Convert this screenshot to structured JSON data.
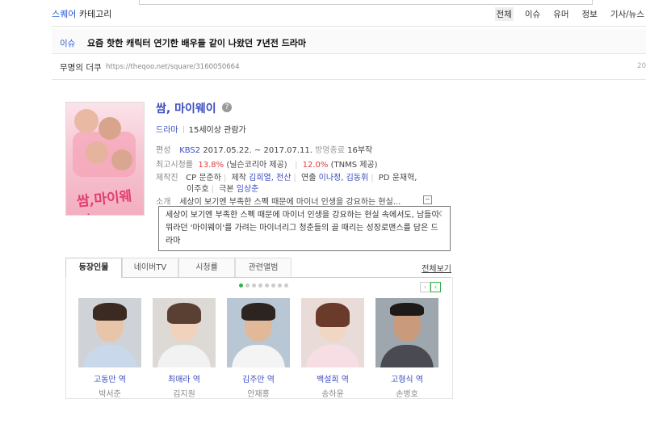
{
  "category": {
    "title_prefix": "스퀘어",
    "title_suffix": " 카테고리",
    "nav": [
      "전체",
      "이슈",
      "유머",
      "정보",
      "기사/뉴스"
    ]
  },
  "issue": {
    "tag": "이슈",
    "headline": "요즘 핫한 캐릭터 연기한 배우들 같이 나왔던 7년전 드라마"
  },
  "source": {
    "name": "무명의 더쿠",
    "url": "https://theqoo.net/square/3160050664",
    "number": "20"
  },
  "drama": {
    "title": "쌈, 마이웨이",
    "help": "?",
    "genre": "드라마",
    "rating_age": "15세이상 관람가",
    "poster_text": "쌈,마이웨이",
    "broadcast": {
      "label": "편성",
      "channel": "KBS2",
      "dates": " 2017.05.22. ~ 2017.07.11. ",
      "status": "방영종료",
      "episodes": " 16부작"
    },
    "viewership": {
      "label": "최고시청률",
      "value1": "13.8%",
      "src1": "(닐슨코리아 제공)",
      "value2": "12.0%",
      "src2": "(TNMS 제공)"
    },
    "crew": {
      "label": "제작진",
      "cp_label": "CP",
      "cp": "문준하",
      "prod_label": "제작",
      "prod": "김희열, 전산",
      "dir_label": "연출",
      "dir": "이나정, 김동휘",
      "pd_label": "PD",
      "pd": "윤재혁,",
      "pd2": "이주호",
      "writer_label": "극본",
      "writer": "임상춘"
    },
    "summary": {
      "label": "소개",
      "short": "세상이 보기엔 부족한 스펙 때문에 마이너 인생을 강요하는 현실...",
      "toggle": "−"
    },
    "popup": {
      "text": "세상이 보기엔 부족한 스펙 때문에 마이너 인생을 강요하는 현실 속에서도, 남들이 뭐라던 '마이웨이'를 가려는 마이너리그 청춘들의 골 때리는 성장로맨스를 담은 드라마",
      "close": "✕"
    }
  },
  "tabs": [
    "등장인물",
    "네이버TV",
    "시청률",
    "관련앨범"
  ],
  "all_view": "전체보기",
  "carousel": {
    "pages": 8,
    "current": 1,
    "prev": "‹",
    "next": "›"
  },
  "cast": [
    {
      "role": "고동만 역",
      "actor": "박서준",
      "shirt": "#c9d8ea"
    },
    {
      "role": "최애라 역",
      "actor": "김지원",
      "shirt": "#f2f2f2"
    },
    {
      "role": "김주만 역",
      "actor": "안재홍",
      "shirt": "#f4f4f4"
    },
    {
      "role": "백설희 역",
      "actor": "송하윤",
      "shirt": "#f7dde4"
    },
    {
      "role": "고형식 역",
      "actor": "손병호",
      "shirt": "#4a4a52"
    }
  ]
}
